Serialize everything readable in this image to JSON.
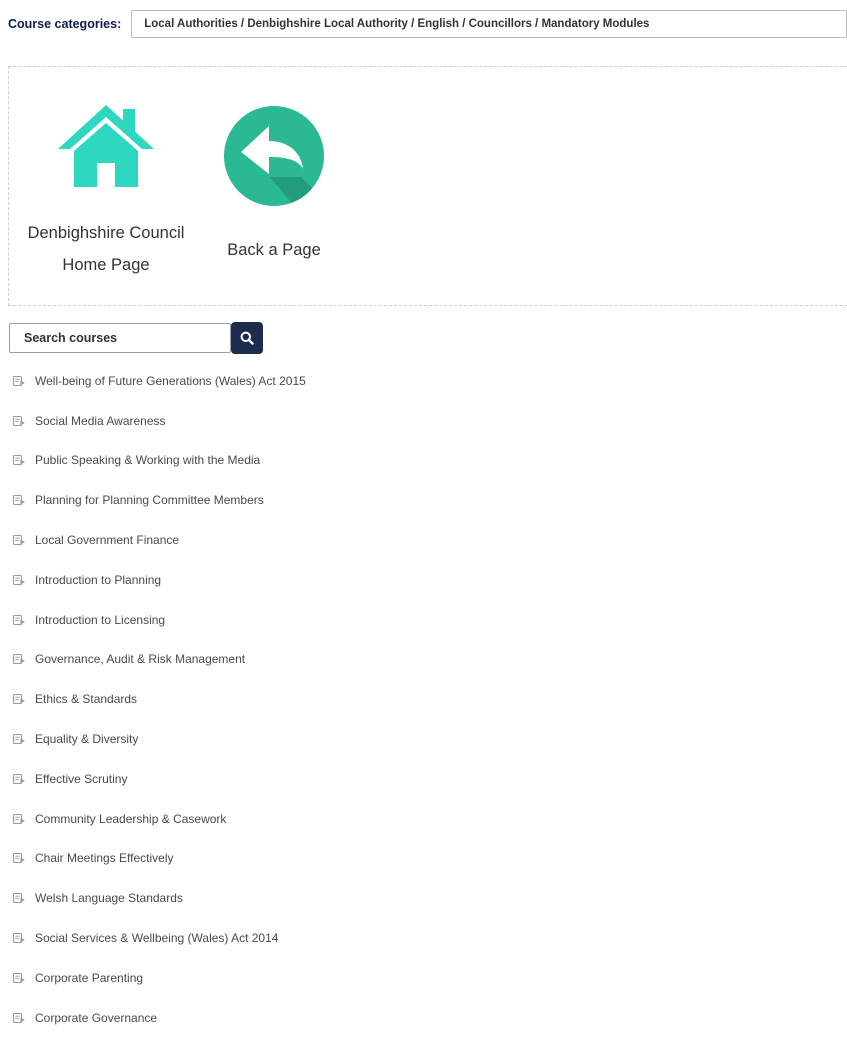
{
  "category": {
    "label": "Course categories:",
    "selected": "Local Authorities / Denbighshire Local Authority / English / Councillors / Mandatory Modules"
  },
  "tiles": {
    "home": {
      "icon": "house-icon",
      "line1": "Denbighshire Council",
      "line2": "Home Page",
      "color": "#2ed8c0"
    },
    "back": {
      "icon": "back-arrow-icon",
      "label": "Back a Page",
      "color": "#2ab993"
    }
  },
  "search": {
    "placeholder": "Search courses",
    "button_icon": "search-icon",
    "button_color": "#1c2b4e"
  },
  "courses": [
    {
      "name": "Well-being of Future Generations (Wales) Act 2015",
      "icon": "course-icon"
    },
    {
      "name": "Social Media Awareness",
      "icon": "course-icon"
    },
    {
      "name": "Public Speaking & Working with the Media",
      "icon": "course-icon"
    },
    {
      "name": "Planning for Planning Committee Members",
      "icon": "course-icon"
    },
    {
      "name": "Local Government Finance",
      "icon": "course-icon"
    },
    {
      "name": "Introduction to Planning",
      "icon": "course-icon"
    },
    {
      "name": "Introduction to Licensing",
      "icon": "course-icon"
    },
    {
      "name": "Governance, Audit & Risk Management",
      "icon": "course-icon"
    },
    {
      "name": "Ethics & Standards",
      "icon": "course-icon"
    },
    {
      "name": "Equality & Diversity",
      "icon": "course-icon"
    },
    {
      "name": "Effective Scrutiny",
      "icon": "course-icon"
    },
    {
      "name": "Community Leadership & Casework",
      "icon": "course-icon"
    },
    {
      "name": "Chair Meetings Effectively",
      "icon": "course-icon"
    },
    {
      "name": "Welsh Language Standards",
      "icon": "course-icon"
    },
    {
      "name": "Social Services & Wellbeing (Wales) Act 2014",
      "icon": "course-icon"
    },
    {
      "name": "Corporate Parenting",
      "icon": "course-icon"
    },
    {
      "name": "Corporate Governance",
      "icon": "course-icon"
    }
  ]
}
